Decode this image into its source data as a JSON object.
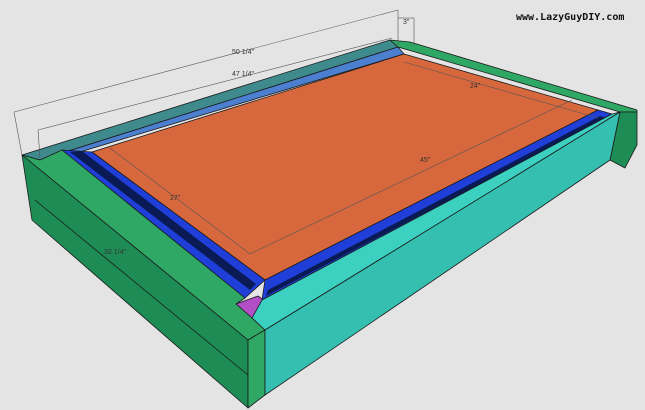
{
  "credit": "www.LazyGuyDIY.com",
  "dimensions": {
    "overall_length": "50 1/4\"",
    "inner_length": "47 1/4\"",
    "board_width": "3\"",
    "panel_short": "24\"",
    "panel_long": "45\"",
    "panel_width": "27\"",
    "overall_width": "32 1/4\""
  },
  "colors": {
    "background": "#e4e4e4",
    "frame_green": "#2fa865",
    "frame_teal": "#3cd0c0",
    "panel_orange": "#d7683d",
    "rail_blue": "#1f3fd8",
    "inner_blue": "#4d7fd0",
    "corner_magenta": "#b34fc6"
  }
}
